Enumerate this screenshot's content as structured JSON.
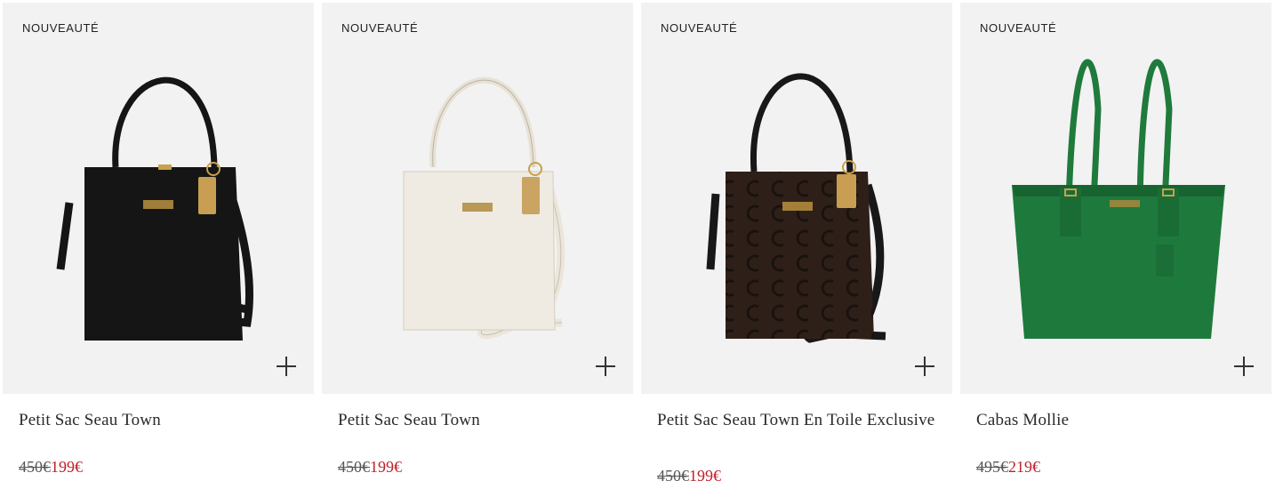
{
  "products": [
    {
      "badge": "NOUVEAUTÉ",
      "name": "Petit Sac Seau Town",
      "old_price": "450€",
      "new_price": "199€",
      "image": "black-bucket-bag",
      "color": "#141414"
    },
    {
      "badge": "NOUVEAUTÉ",
      "name": "Petit Sac Seau Town",
      "old_price": "450€",
      "new_price": "199€",
      "image": "white-bucket-bag",
      "color": "#efebe2"
    },
    {
      "badge": "NOUVEAUTÉ",
      "name": "Petit Sac Seau Town En Toile Exclusive",
      "old_price": "450€",
      "new_price": "199€",
      "image": "brown-signature-bucket-bag",
      "color": "#2e2019"
    },
    {
      "badge": "NOUVEAUTÉ",
      "name": "Cabas Mollie",
      "old_price": "495€",
      "new_price": "219€",
      "image": "green-tote-bag",
      "color": "#1e7a3c"
    }
  ],
  "colors": {
    "sale_price": "#c0202a",
    "tile_background": "#f2f2f2"
  }
}
